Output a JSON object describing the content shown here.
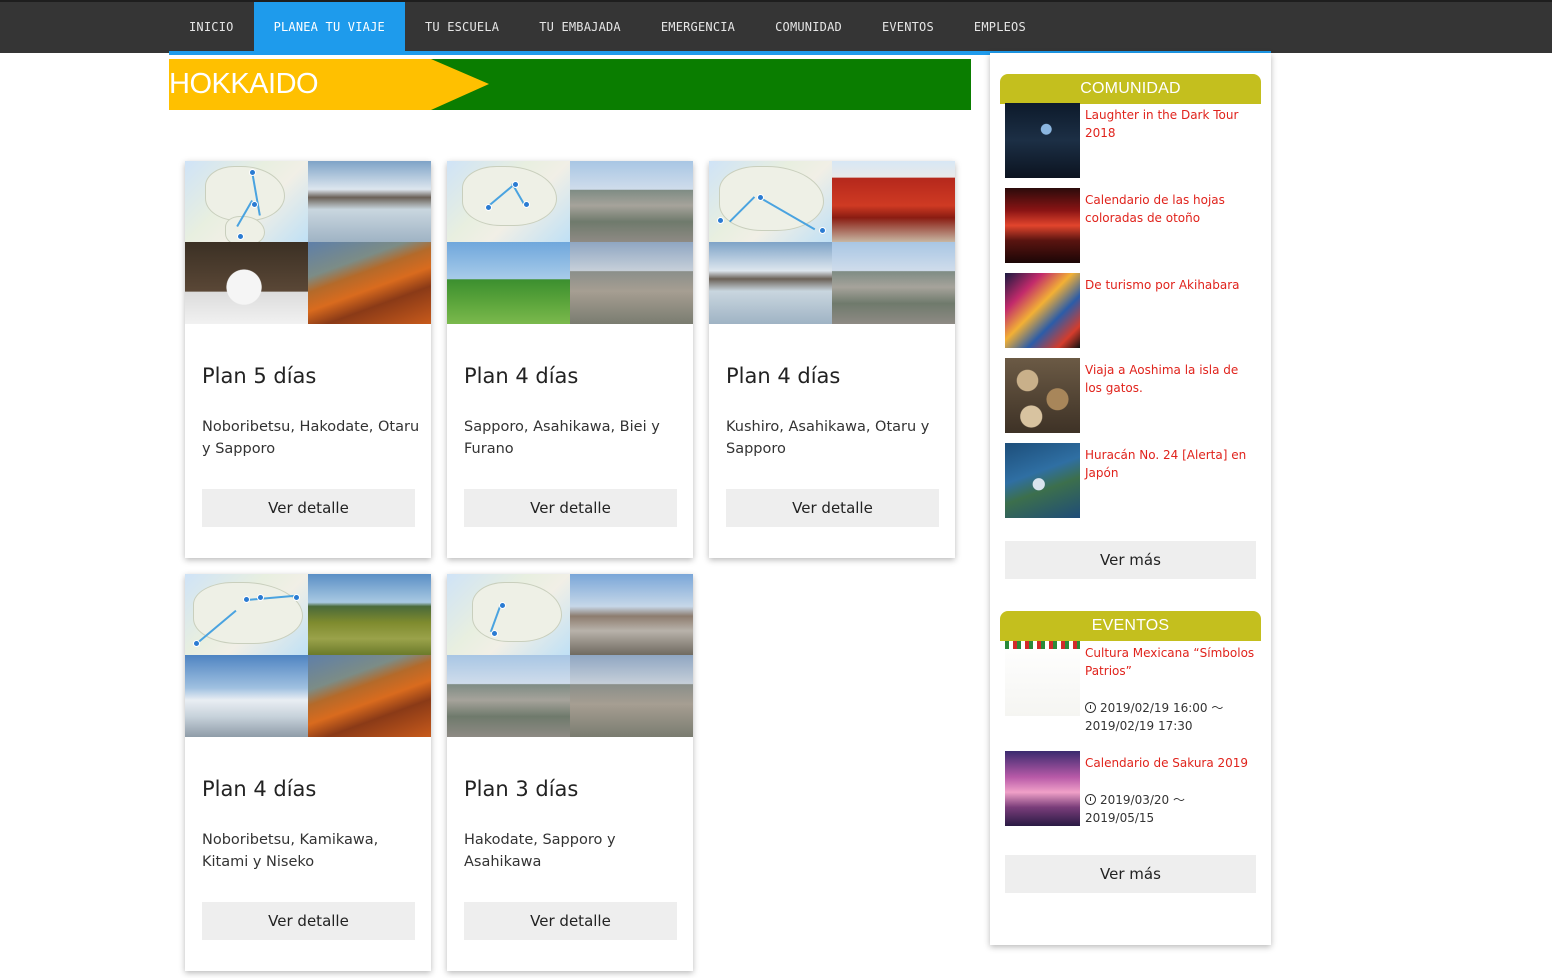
{
  "nav": {
    "items": [
      {
        "label": "INICIO",
        "active": false
      },
      {
        "label": "PLANEA TU VIAJE",
        "active": true
      },
      {
        "label": "TU ESCUELA",
        "active": false
      },
      {
        "label": "TU EMBAJADA",
        "active": false
      },
      {
        "label": "EMERGENCIA",
        "active": false
      },
      {
        "label": "COMUNIDAD",
        "active": false
      },
      {
        "label": "EVENTOS",
        "active": false
      },
      {
        "label": "EMPLEOS",
        "active": false
      }
    ]
  },
  "colors": {
    "nav_bg": "#353535",
    "nav_active": "#1e9bec",
    "banner_yellow": "#ffc000",
    "banner_green": "#0a7d00",
    "sidebar_head": "#c4bf1e",
    "link_red": "#e0231c"
  },
  "banner": {
    "title": "HOKKAIDO"
  },
  "plans": [
    {
      "title": "Plan 5 días",
      "desc": "Noboribetsu, Hakodate, Otaru y Sapporo",
      "button": "Ver detalle"
    },
    {
      "title": "Plan 4 días",
      "desc": "Sapporo, Asahikawa, Biei y Furano",
      "button": "Ver detalle"
    },
    {
      "title": "Plan 4 días",
      "desc": "Kushiro, Asahikawa, Otaru y Sapporo",
      "button": "Ver detalle"
    },
    {
      "title": "Plan 4 días",
      "desc": "Noboribetsu, Kamikawa, Kitami y Niseko",
      "button": "Ver detalle"
    },
    {
      "title": "Plan 3 días",
      "desc": "Hakodate, Sapporo y Asahikawa",
      "button": "Ver detalle"
    }
  ],
  "sidebar": {
    "comunidad": {
      "heading": "COMUNIDAD",
      "items": [
        {
          "title": "Laughter in the Dark Tour 2018"
        },
        {
          "title": "Calendario de las hojas coloradas de otoño"
        },
        {
          "title": "De turismo por Akihabara"
        },
        {
          "title": "Viaja a Aoshima la isla de los gatos."
        },
        {
          "title": "Huracán No. 24 [Alerta] en Japón"
        }
      ],
      "more": "Ver más"
    },
    "eventos": {
      "heading": "EVENTOS",
      "items": [
        {
          "title": "Cultura Mexicana “Símbolos Patrios”",
          "date": "2019/02/19 16:00 〜 2019/02/19 17:30"
        },
        {
          "title": "Calendario de Sakura 2019",
          "date": "2019/03/20 〜 2019/05/15"
        }
      ],
      "more": "Ver más"
    }
  }
}
